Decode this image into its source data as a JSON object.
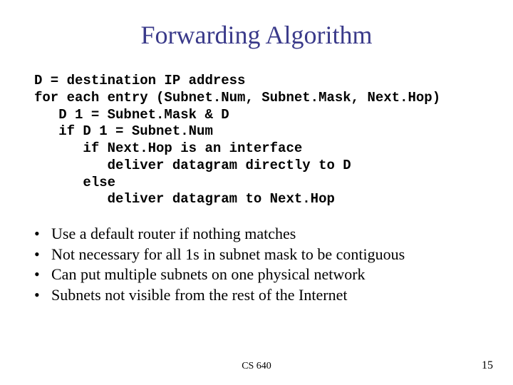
{
  "title": "Forwarding Algorithm",
  "code": {
    "l1": "D = destination IP address",
    "l2": "for each entry (Subnet.Num, Subnet.Mask, Next.Hop)",
    "l3": "   D 1 = Subnet.Mask & D",
    "l4": "   if D 1 = Subnet.Num",
    "l5": "      if Next.Hop is an interface",
    "l6": "         deliver datagram directly to D",
    "l7": "      else",
    "l8": "         deliver datagram to Next.Hop"
  },
  "bullets": {
    "b1": "Use a default router if nothing matches",
    "b2": "Not necessary for all 1s in subnet mask to be contiguous",
    "b3": "Can put multiple subnets on one physical network",
    "b4": "Subnets not visible from the rest of the Internet"
  },
  "dot": "•",
  "footer": {
    "center": "CS 640",
    "page": "15"
  }
}
